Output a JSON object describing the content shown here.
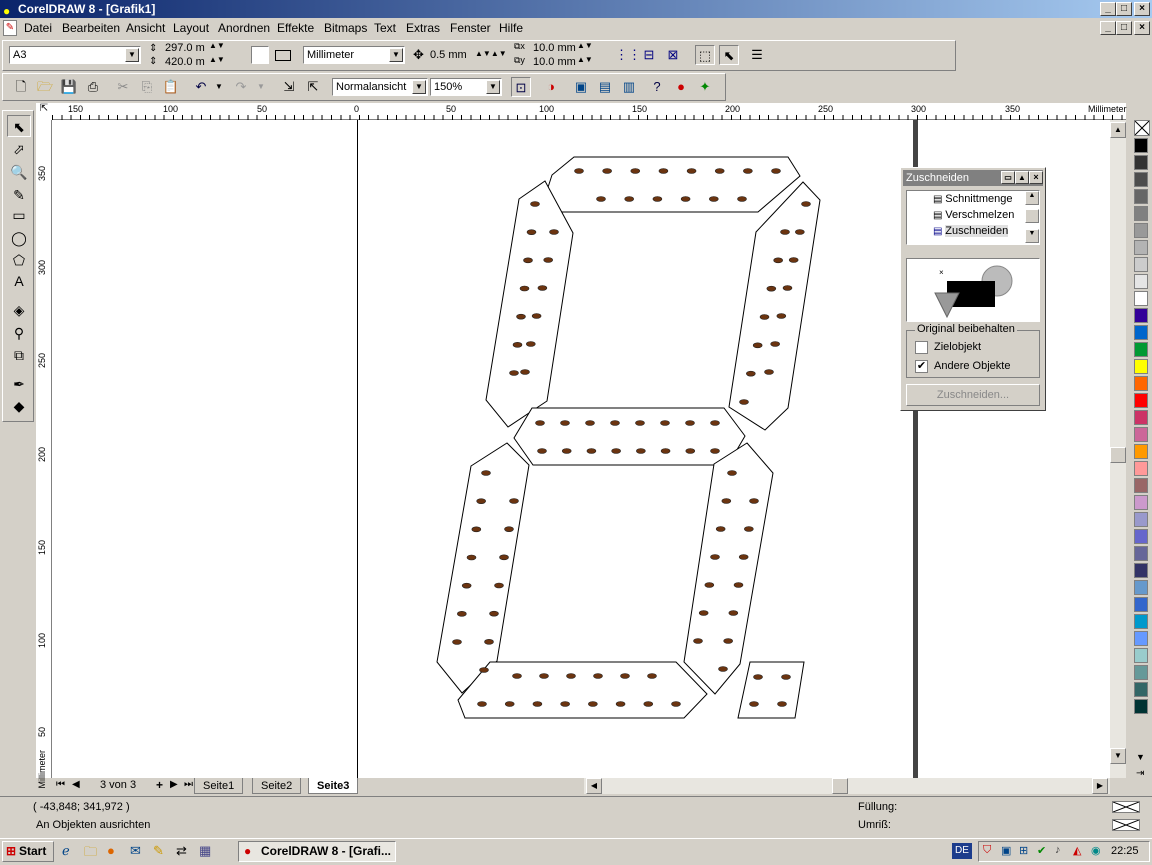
{
  "window": {
    "title": "CorelDRAW 8 - [Grafik1]"
  },
  "menu": [
    "Datei",
    "Bearbeiten",
    "Ansicht",
    "Layout",
    "Anordnen",
    "Effekte",
    "Bitmaps",
    "Text",
    "Extras",
    "Fenster",
    "Hilfe"
  ],
  "property_bar": {
    "paper": "A3",
    "width": "297.0 m",
    "height": "420.0 m",
    "units": "Millimeter",
    "nudge": "0.5 mm",
    "dup_x": "10.0 mm",
    "dup_y": "10.0 mm"
  },
  "standard_bar": {
    "view_mode": "Normalansicht",
    "zoom": "150%"
  },
  "ruler": {
    "h_unit": "Millimeter",
    "v_unit": "Millimeter",
    "h_ticks": [
      "150",
      "100",
      "50",
      "0",
      "50",
      "100",
      "150",
      "200",
      "250",
      "300",
      "350"
    ],
    "v_ticks": [
      "350",
      "300",
      "250",
      "200",
      "150",
      "100",
      "50"
    ]
  },
  "docker": {
    "title": "Zuschneiden",
    "list": [
      "Schnittmenge",
      "Verschmelzen",
      "Zuschneiden"
    ],
    "group_label": "Original beibehalten",
    "opt1": "Zielobjekt",
    "opt1_checked": false,
    "opt2": "Andere Objekte",
    "opt2_checked": true,
    "apply_btn": "Zuschneiden..."
  },
  "pages": {
    "counter": "3 von 3",
    "tabs": [
      "Seite1",
      "Seite2",
      "Seite3"
    ],
    "active": "Seite3"
  },
  "status": {
    "coords": "( -43,848; 341,972 )",
    "hint": "An Objekten ausrichten",
    "fill_label": "Füllung:",
    "outline_label": "Umriß:"
  },
  "taskbar": {
    "start": "Start",
    "task": "CorelDRAW 8 - [Grafi...",
    "lang": "DE",
    "time": "22:25"
  },
  "palette": [
    "#000000",
    "#333333",
    "#4d4d4d",
    "#666666",
    "#808080",
    "#999999",
    "#b3b3b3",
    "#cccccc",
    "#e5e5e5",
    "#ffffff",
    "#330099",
    "#0066cc",
    "#009933",
    "#ffff00",
    "#ff6600",
    "#ff0000",
    "#cc3366",
    "#cc6699",
    "#ff9900",
    "#ff9999",
    "#996666",
    "#cc99cc",
    "#9999cc",
    "#6666cc",
    "#666699",
    "#333366",
    "#6699cc",
    "#3366cc",
    "#0099cc",
    "#6699ff",
    "#99cccc",
    "#669999",
    "#336666",
    "#003333"
  ]
}
